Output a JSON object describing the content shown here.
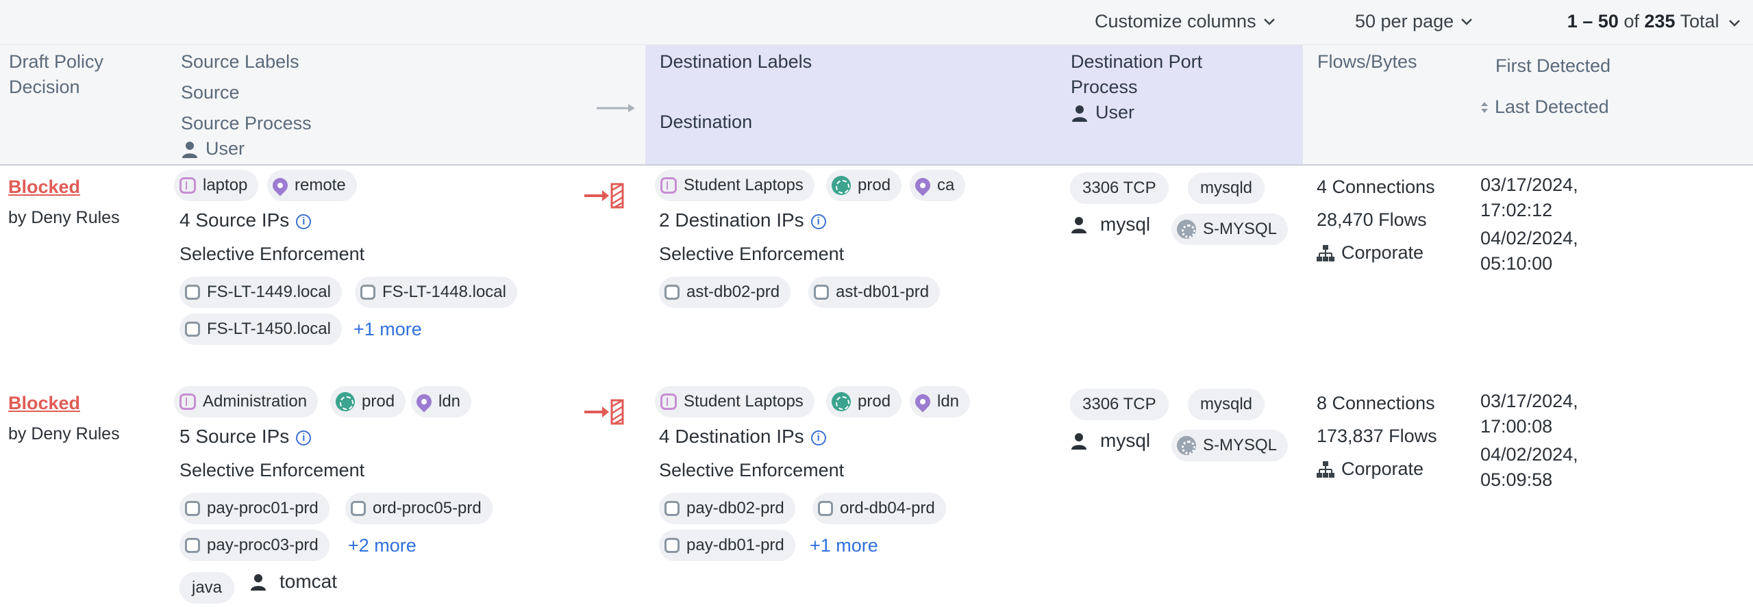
{
  "toolbar": {
    "customize_label": "Customize columns",
    "per_page_label": "50 per page",
    "range_label": "1 – 50",
    "of_label": "of",
    "total_count": "235",
    "total_label": "Total"
  },
  "columns": {
    "decision": [
      "Draft Policy",
      "Decision"
    ],
    "source": [
      "Source Labels",
      "Source",
      "Source Process",
      "User"
    ],
    "destination_labels": "Destination Labels",
    "destination": "Destination",
    "dest_port": [
      "Destination Port",
      "Process",
      "User"
    ],
    "flows": "Flows/Bytes",
    "first_detected": "First Detected",
    "last_detected": "Last Detected"
  },
  "colors": {
    "blocked": "#e05b56",
    "dest_header_bg": "#e2e3f7",
    "link": "#2f6fdc"
  },
  "rows": [
    {
      "decision": "Blocked",
      "decision_by": "by Deny Rules",
      "source_labels": [
        "laptop",
        "remote"
      ],
      "source_ips": "4 Source IPs",
      "source_enforcement": "Selective Enforcement",
      "source_workloads": [
        "FS-LT-1449.local",
        "FS-LT-1448.local",
        "FS-LT-1450.local"
      ],
      "source_more": "+1 more",
      "dest_labels": [
        "Student Laptops",
        "prod",
        "ca"
      ],
      "dest_ips": "2 Destination IPs",
      "dest_enforcement": "Selective Enforcement",
      "dest_workloads": [
        "ast-db02-prd",
        "ast-db01-prd"
      ],
      "port": "3306 TCP",
      "process": "mysqld",
      "user": "mysql",
      "service": "S-MYSQL",
      "connections": "4 Connections",
      "flows": "28,470 Flows",
      "network": "Corporate",
      "first_detected": [
        "03/17/2024,",
        "17:02:12"
      ],
      "last_detected": [
        "04/02/2024,",
        "05:10:00"
      ]
    },
    {
      "decision": "Blocked",
      "decision_by": "by Deny Rules",
      "source_labels": [
        "Administration",
        "prod",
        "ldn"
      ],
      "source_ips": "5 Source IPs",
      "source_enforcement": "Selective Enforcement",
      "source_workloads": [
        "pay-proc01-prd",
        "ord-proc05-prd",
        "pay-proc03-prd"
      ],
      "source_more": "+2 more",
      "source_process": "java",
      "source_user": "tomcat",
      "dest_labels": [
        "Student Laptops",
        "prod",
        "ldn"
      ],
      "dest_ips": "4 Destination IPs",
      "dest_enforcement": "Selective Enforcement",
      "dest_workloads": [
        "pay-db02-prd",
        "ord-db04-prd",
        "pay-db01-prd"
      ],
      "dest_more": "+1 more",
      "port": "3306 TCP",
      "process": "mysqld",
      "user": "mysql",
      "service": "S-MYSQL",
      "connections": "8 Connections",
      "flows": "173,837 Flows",
      "network": "Corporate",
      "first_detected": [
        "03/17/2024,",
        "17:00:08"
      ],
      "last_detected": [
        "04/02/2024,",
        "05:09:58"
      ]
    }
  ]
}
